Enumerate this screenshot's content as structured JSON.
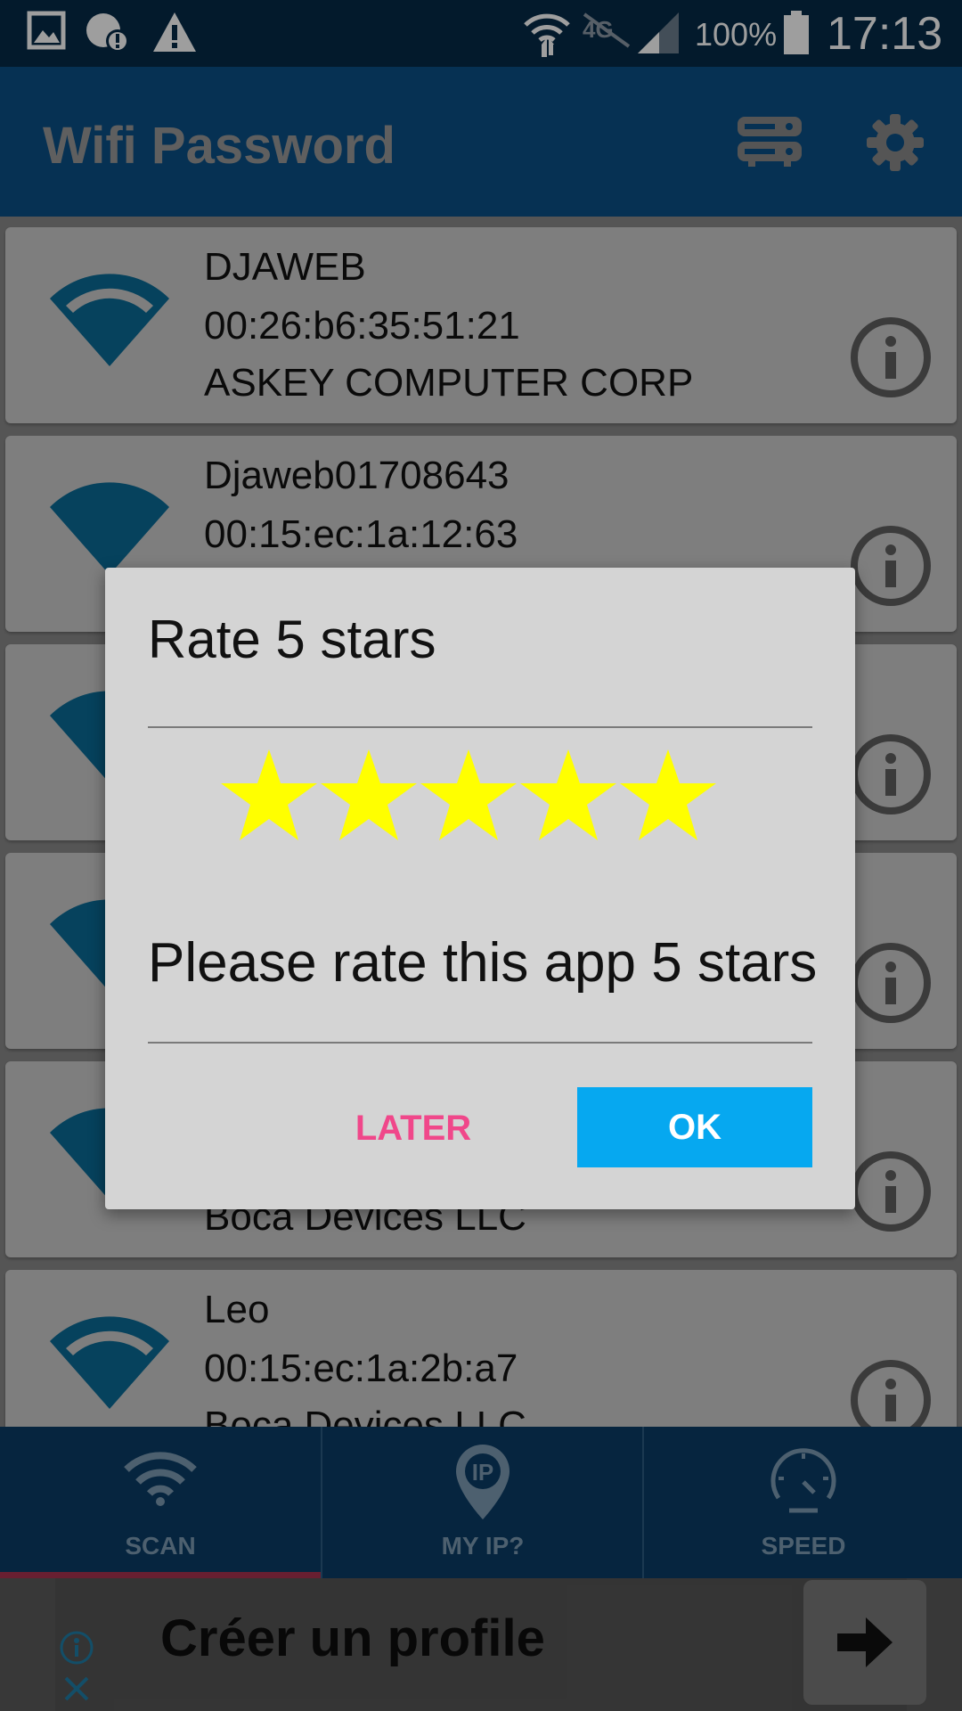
{
  "status_bar": {
    "battery": "100%",
    "time": "17:13",
    "icons": [
      "gallery-icon",
      "alert-badge-icon",
      "warning-icon",
      "wifi-signal-icon",
      "lte-icon",
      "cell-signal-icon",
      "battery-icon"
    ]
  },
  "app_bar": {
    "title": "Wifi Password",
    "actions": [
      "router-icon",
      "gear-icon"
    ]
  },
  "networks": [
    {
      "ssid": "DJAWEB",
      "mac": "00:26:b6:35:51:21",
      "vendor": "ASKEY COMPUTER CORP"
    },
    {
      "ssid": "Djaweb01708643",
      "mac": "00:15:ec:1a:12:63",
      "vendor": ""
    },
    {
      "ssid": "",
      "mac": "",
      "vendor": ""
    },
    {
      "ssid": "",
      "mac": "",
      "vendor": ""
    },
    {
      "ssid": "",
      "mac": "",
      "vendor": "Boca Devices LLC"
    },
    {
      "ssid": "Leo",
      "mac": "00:15:ec:1a:2b:a7",
      "vendor": "Boca Devices LLC"
    }
  ],
  "dialog": {
    "title": "Rate 5 stars",
    "rating": 5,
    "rating_max": 5,
    "message": "Please rate this app 5 stars",
    "later_label": "LATER",
    "ok_label": "OK"
  },
  "bottom_nav": {
    "items": [
      {
        "label": "SCAN",
        "icon": "wifi-icon",
        "active": true
      },
      {
        "label": "MY IP?",
        "icon": "ip-pin-icon",
        "active": false
      },
      {
        "label": "SPEED",
        "icon": "speedometer-icon",
        "active": false
      }
    ]
  },
  "ad": {
    "text": "Créer un profile"
  },
  "colors": {
    "status_bar": "#062a47",
    "app_bar": "#0a4f86",
    "accent_ok": "#06a8f0",
    "later_text": "#f0478a",
    "star": "#ffff00"
  }
}
